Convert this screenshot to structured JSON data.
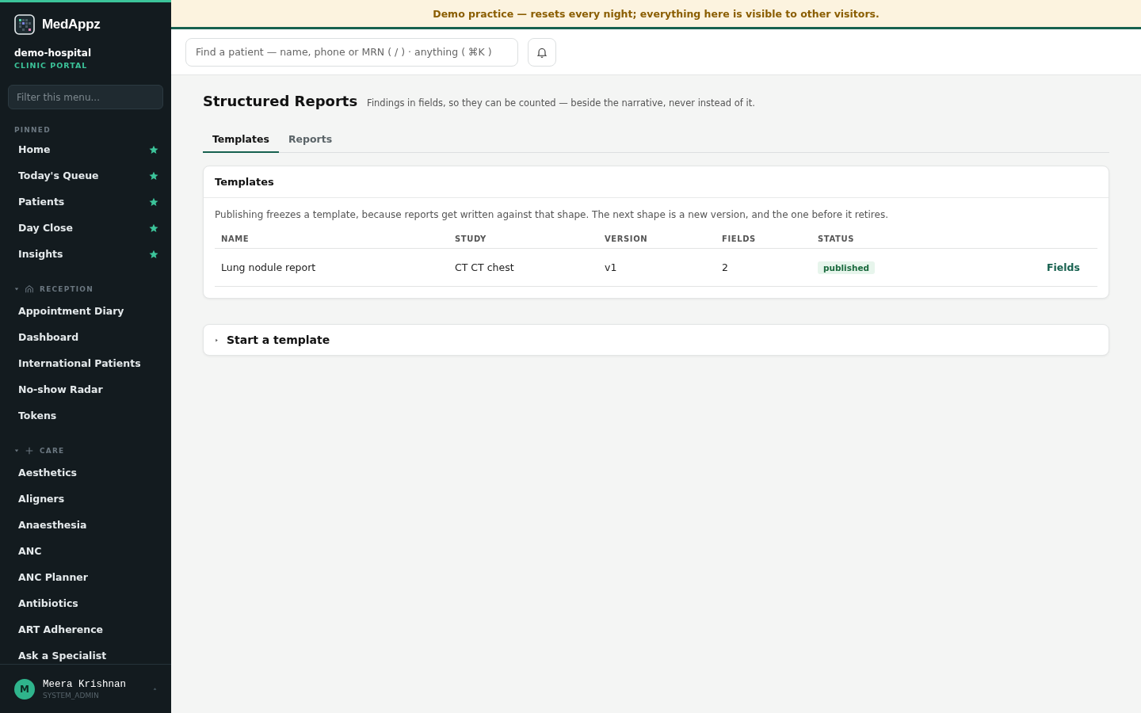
{
  "banner": {
    "text": "Demo practice — resets every night; everything here is visible to other visitors."
  },
  "sidebar": {
    "brand": "MedAppz",
    "tenant": "demo-hospital",
    "portal": "CLINIC PORTAL",
    "filter": {
      "placeholder": "Filter this menu..."
    },
    "groups": [
      {
        "title": "PINNED",
        "kind": "pinned",
        "items": [
          {
            "label": "Home",
            "starred": true
          },
          {
            "label": "Today's Queue",
            "starred": true
          },
          {
            "label": "Patients",
            "starred": true
          },
          {
            "label": "Day Close",
            "starred": true
          },
          {
            "label": "Insights",
            "starred": true
          }
        ]
      },
      {
        "title": "RECEPTION",
        "kind": "reception",
        "expanded": true,
        "items": [
          {
            "label": "Appointment Diary"
          },
          {
            "label": "Dashboard"
          },
          {
            "label": "International Patients"
          },
          {
            "label": "No-show Radar"
          },
          {
            "label": "Tokens"
          }
        ]
      },
      {
        "title": "CARE",
        "kind": "care",
        "expanded": true,
        "items": [
          {
            "label": "Aesthetics"
          },
          {
            "label": "Aligners"
          },
          {
            "label": "Anaesthesia"
          },
          {
            "label": "ANC"
          },
          {
            "label": "ANC Planner"
          },
          {
            "label": "Antibiotics"
          },
          {
            "label": "ART Adherence"
          },
          {
            "label": "Ask a Specialist"
          }
        ]
      }
    ],
    "user": {
      "initial": "M",
      "name": "Meera Krishnan",
      "role": "SYSTEM_ADMIN"
    }
  },
  "topbar": {
    "search": {
      "placeholder": "Find a patient — name, phone or MRN ( / ) · anything ( ⌘K )"
    }
  },
  "page": {
    "title": "Structured Reports",
    "subtitle": "Findings in fields, so they can be counted — beside the narrative, never instead of it.",
    "tabs": [
      {
        "label": "Templates",
        "selected": true
      },
      {
        "label": "Reports",
        "selected": false
      }
    ],
    "templates_card": {
      "title": "Templates",
      "note": "Publishing freezes a template, because reports get written against that shape. The next shape is a new version, and the one before it retires.",
      "table": {
        "columns": [
          "NAME",
          "STUDY",
          "VERSION",
          "FIELDS",
          "STATUS"
        ],
        "rows": [
          {
            "name": "Lung nodule report",
            "study": "CT CT chest",
            "version": "v1",
            "fields": "2",
            "status": "published",
            "action": "Fields"
          }
        ]
      }
    },
    "start_card": {
      "title": "Start a template",
      "expanded": false
    }
  }
}
